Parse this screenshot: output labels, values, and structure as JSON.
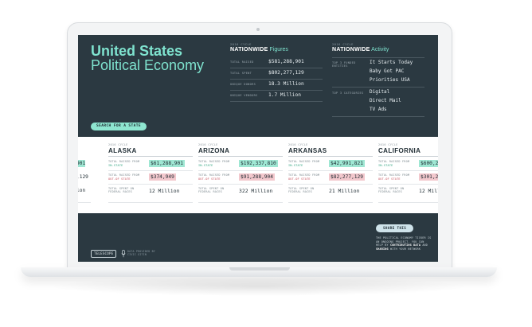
{
  "hero": {
    "title": "United States",
    "subtitle": "Political Economy",
    "search_button": "SEARCH FOR A STATE"
  },
  "figures": {
    "cycle": "2016 CYCLE",
    "title_strong": "NATIONWIDE",
    "title_rest": "Figures",
    "rows": [
      {
        "label": "TOTAL RAISED",
        "value": "$581,288,901"
      },
      {
        "label": "TOTAL SPENT",
        "value": "$802,277,129"
      },
      {
        "label": "UNIQUE DONORS",
        "value": "18.3 Million"
      },
      {
        "label": "UNIQUE VENDORS",
        "value": "1.7 Million"
      }
    ]
  },
  "activity": {
    "cycle": "2016 CYCLE",
    "title_strong": "NATIONWIDE",
    "title_rest": "Activity",
    "funded_label": "TOP 3 FUNDED ENTITIES",
    "funded": [
      "It Starts Today",
      "Baby Got PAC",
      "Priorities USA"
    ],
    "categories_label": "TOP 3 CATEGORIES",
    "categories": [
      "Digital",
      "Direct Mail",
      "TV Ads"
    ]
  },
  "card_labels": {
    "cycle": "2016 CYCLE",
    "raised_in": "TOTAL RAISED FROM",
    "in_state": "IN-STATE",
    "raised_out": "TOTAL RAISED FROM",
    "out_state": "OUT-OF STATE",
    "spent_federal": "TOTAL SPENT ON FEDERAL RACES"
  },
  "states": [
    {
      "name": "ALASKA",
      "in_state": "$61,288,901",
      "out_state": "$374,949",
      "federal": "12 Million"
    },
    {
      "name": "ARIZONA",
      "in_state": "$192,337,810",
      "out_state": "$91,288,904",
      "federal": "322 Million"
    },
    {
      "name": "ARKANSAS",
      "in_state": "$42,991,821",
      "out_state": "$82,277,129",
      "federal": "21 Million"
    },
    {
      "name": "CALIFORNIA",
      "in_state": "$600,291",
      "out_state": "$301,27",
      "federal": "12 Millio"
    }
  ],
  "left_partial": {
    "in_state": "901",
    "out_state": ",129",
    "federal": "ion"
  },
  "footer": {
    "brand": "TELESCOPE",
    "powered_text": "DATA PROVIDED BY CIVIC GITIN",
    "share_button": "SHARE THIS",
    "note_line1": "THE POLITICAL ECONOMY TICKER IS",
    "note_line2": "AN ONGOING PROJECT. YOU CAN",
    "note_line3_pre": "HELP BY",
    "note_line3_strong": "CONTRIBUTING DATA",
    "note_line3_post": "AND",
    "note_line4_strong": "SHARING",
    "note_line4_post": "WITH YOUR NETWORK"
  },
  "colors": {
    "panel": "#2b3941",
    "accent": "#7fe3cf",
    "in_state_chip": "#9fe7d3",
    "out_state_chip": "#f3c8cd"
  }
}
